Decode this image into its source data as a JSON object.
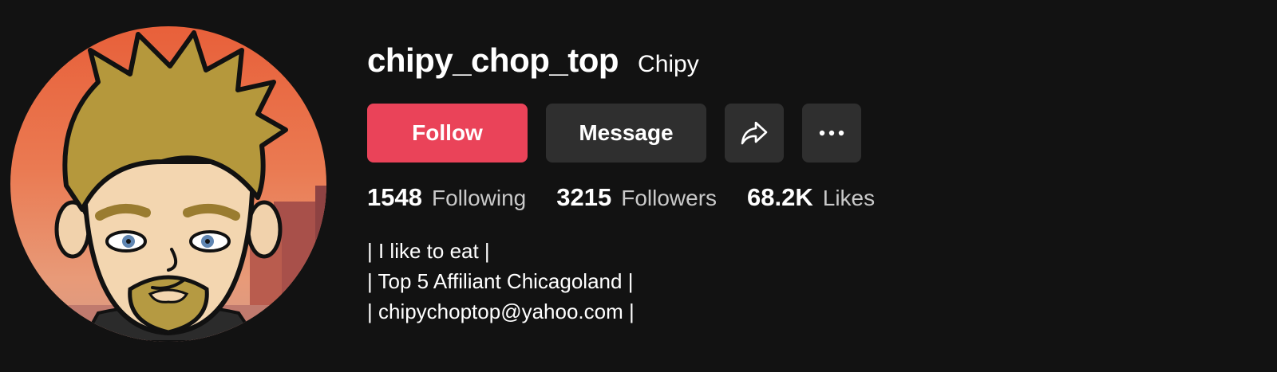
{
  "profile": {
    "username": "chipy_chop_top",
    "nickname": "Chipy",
    "avatar_icon": "cartoon-avatar-icon"
  },
  "actions": {
    "follow_label": "Follow",
    "message_label": "Message",
    "share_icon": "share-icon",
    "more_icon": "more-icon"
  },
  "stats": {
    "following": {
      "value": "1548",
      "label": "Following"
    },
    "followers": {
      "value": "3215",
      "label": "Followers"
    },
    "likes": {
      "value": "68.2K",
      "label": "Likes"
    }
  },
  "bio": {
    "lines": [
      "| I like to eat |",
      "| Top 5 Affiliant Chicagoland |",
      "| chipychoptop@yahoo.com |"
    ]
  },
  "colors": {
    "background": "#121212",
    "follow_button": "#ea4359",
    "secondary_button": "#2f2f2f"
  }
}
